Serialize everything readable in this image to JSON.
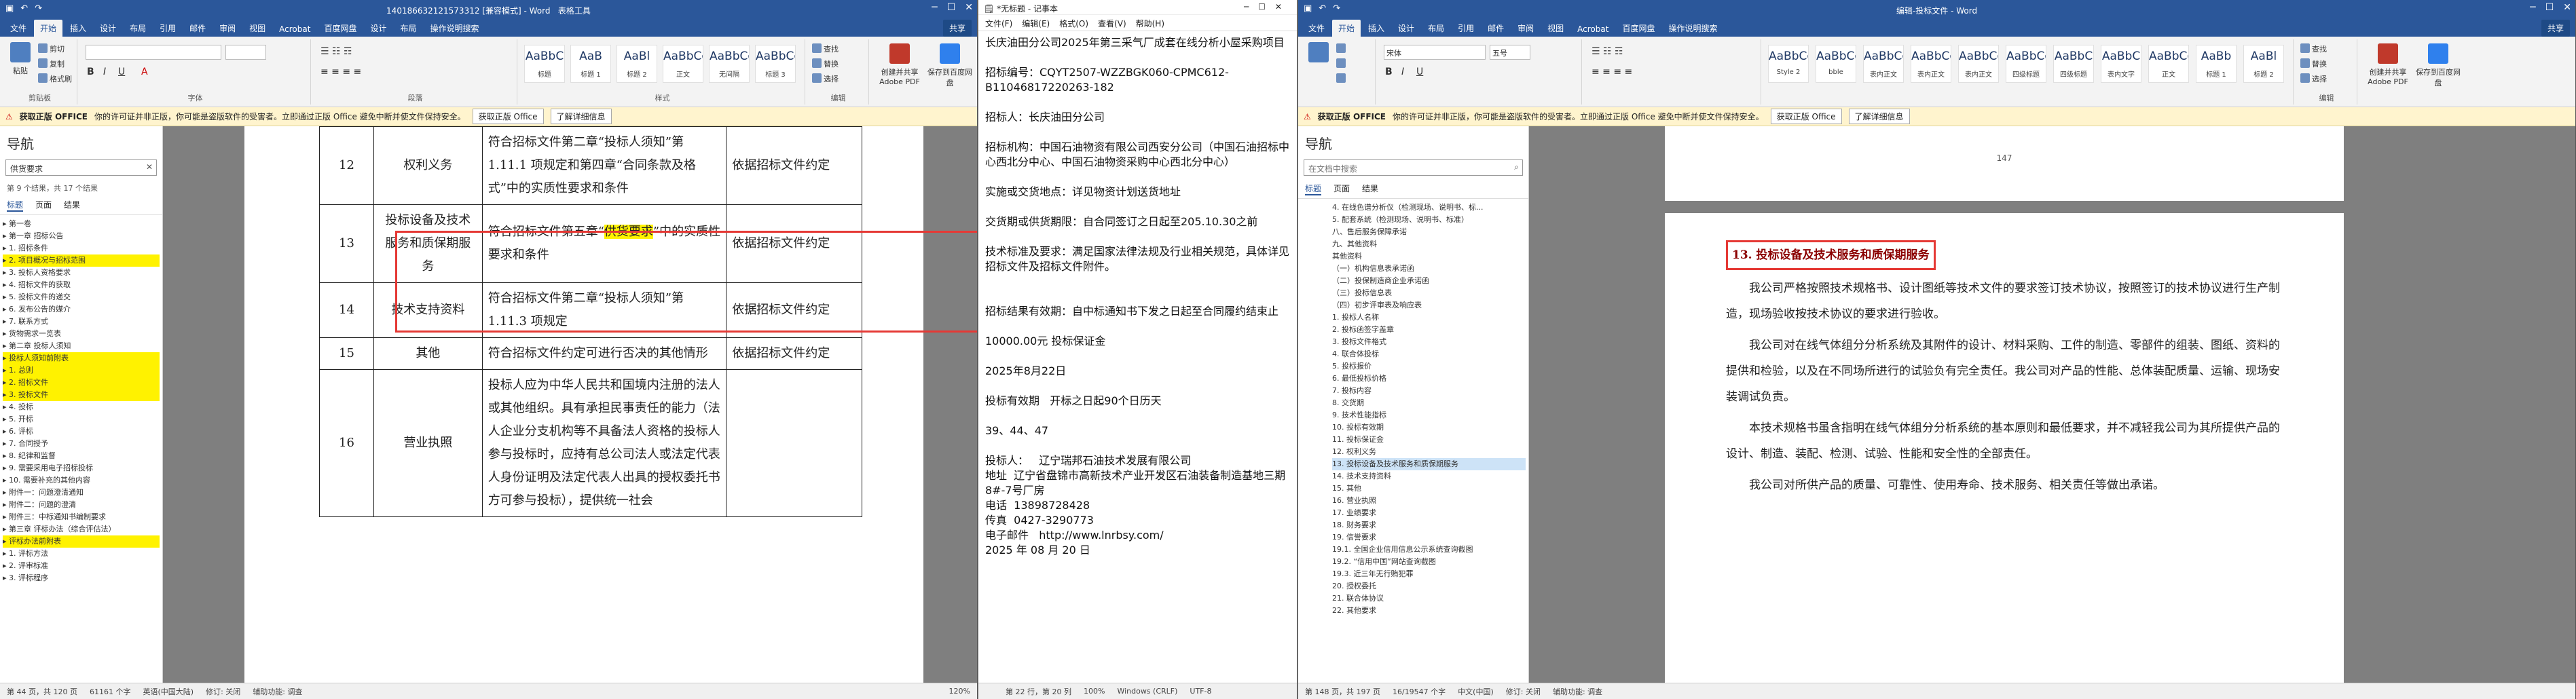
{
  "left": {
    "title": "14018663212157331​2 [兼容模式] - Word",
    "title_tools": "表格工具",
    "tabs": [
      "文件",
      "开始",
      "插入",
      "设计",
      "布局",
      "引用",
      "邮件",
      "审阅",
      "视图",
      "Acrobat",
      "百度网盘",
      "设计",
      "布局",
      "操作说明搜索"
    ],
    "share": "共享",
    "ribbon": {
      "paste": "粘贴",
      "cut": "剪切",
      "copy": "复制",
      "fmt": "格式刷",
      "clipboard": "剪贴板",
      "font_group": "字体",
      "para_group": "段落",
      "styles_group": "样式",
      "edit_group": "编辑",
      "find": "查找",
      "replace": "替换",
      "select": "选择",
      "pdf": "创建并共享 Adobe PDF",
      "baidu": "保存到百度网盘",
      "styles": [
        {
          "p": "AaBbC",
          "n": "标题"
        },
        {
          "p": "AaB",
          "n": "标题 1"
        },
        {
          "p": "AaBl",
          "n": "标题 2"
        },
        {
          "p": "AaBbCcD",
          "n": "正文"
        },
        {
          "p": "AaBbCcD",
          "n": "无间隔"
        },
        {
          "p": "AaBbCc",
          "n": "标题 3"
        }
      ]
    },
    "msg": {
      "label": "获取正版 OFFICE",
      "text": "你的许可证并非正版，你可能是盗版软件的受害者。立即通过正版 Office 避免中断并使文件保持安全。",
      "btn1": "获取正版 Office",
      "btn2": "了解详细信息"
    },
    "nav": {
      "title": "导航",
      "search": "供货要求",
      "result": "第 9 个结果，共 17 个结果",
      "tabs": [
        "标题",
        "页面",
        "结果"
      ],
      "items": [
        {
          "t": "第一卷",
          "h": false
        },
        {
          "t": "第一章 招标公告",
          "h": false
        },
        {
          "t": "1. 招标条件",
          "h": false
        },
        {
          "t": "2. 项目概况与招标范围",
          "h": true
        },
        {
          "t": "3. 投标人资格要求",
          "h": false
        },
        {
          "t": "4. 招标文件的获取",
          "h": false
        },
        {
          "t": "5. 投标文件的递交",
          "h": false
        },
        {
          "t": "6. 发布公告的媒介",
          "h": false
        },
        {
          "t": "7. 联系方式",
          "h": false
        },
        {
          "t": "货物需求一览表",
          "h": false
        },
        {
          "t": "第二章 投标人须知",
          "h": false
        },
        {
          "t": "投标人须知前附表",
          "h": true
        },
        {
          "t": "1. 总则",
          "h": true
        },
        {
          "t": "2. 招标文件",
          "h": true
        },
        {
          "t": "3. 投标文件",
          "h": true
        },
        {
          "t": "4. 投标",
          "h": false
        },
        {
          "t": "5. 开标",
          "h": false
        },
        {
          "t": "6. 评标",
          "h": false
        },
        {
          "t": "7. 合同授予",
          "h": false
        },
        {
          "t": "8. 纪律和监督",
          "h": false
        },
        {
          "t": "9. 需要采用电子招标投标",
          "h": false
        },
        {
          "t": "10. 需要补充的其他内容",
          "h": false
        },
        {
          "t": "附件一：问题澄清通知",
          "h": false
        },
        {
          "t": "附件二：问题的澄清",
          "h": false
        },
        {
          "t": "附件三：中标通知书编制要求",
          "h": false
        },
        {
          "t": "第三章 评标办法（综合评估法）",
          "h": false
        },
        {
          "t": "评标办法前附表",
          "h": true
        },
        {
          "t": "1. 评标方法",
          "h": false
        },
        {
          "t": "2. 评审标准",
          "h": false
        },
        {
          "t": "3. 评标程序",
          "h": false
        }
      ]
    },
    "table": [
      {
        "n": "12",
        "item": "权利义务",
        "req": "符合招标文件第二章“投标人须知”第 1.11.1 项规定和第四章“合同条款及格式”中的实质性要求和条件",
        "basis": "依据招标文件约定"
      },
      {
        "n": "13",
        "item": "投标设备及技术服务和质保期服务",
        "req_a": "符合招标文件第五章“",
        "req_hl": "供货要求",
        "req_b": "”中的实质性要求和条件",
        "basis": "依据招标文件约定"
      },
      {
        "n": "14",
        "item": "技术支持资料",
        "req": "符合招标文件第二章“投标人须知”第 1.11.3 项规定",
        "basis": "依据招标文件约定"
      },
      {
        "n": "15",
        "item": "其他",
        "req": "符合招标文件约定可进行否决的其他情形",
        "basis": "依据招标文件约定"
      },
      {
        "n": "16",
        "item": "营业执照",
        "req": "投标人应为中华人民共和国境内注册的法人或其他组织。具有承担民事责任的能力（法人企业分支机构等不具备法人资格的投标人参与投标时，应持有总公司法人或法定代表人身份证明及法定代表人出具的授权委托书方可参与投标），提供统一社会",
        "basis": ""
      }
    ],
    "status": {
      "page": "第 44 页，共 120 页",
      "words": "61161 个字",
      "lang": "英语(中国大陆)",
      "track": "修订: 关闭",
      "access": "辅助功能: 调查",
      "zoom": "120%"
    }
  },
  "notepad": {
    "title": "*无标题 - 记事本",
    "menu": [
      "文件(F)",
      "编辑(E)",
      "格式(O)",
      "查看(V)",
      "帮助(H)"
    ],
    "text": "长庆油田分公司2025年第三采气厂成套在线分析小屋采购项目\n\n招标编号：CQYT2507-WZZBGK060-CPMC612-B11046817220263-182\n\n招标人：长庆油田分公司\n\n招标机构：中国石油物资有限公司西安分公司（中国石油招标中心西北分中心、中国石油物资采购中心西北分中心）\n\n实施或交货地点：详见物资计划送货地址\n\n交货期或供货期限：自合同签订之日起至205.10.30之前\n\n技术标准及要求：满足国家法律法规及行业相关规范，具体详见招标文件及招标文件附件。\n\n\n招标结果有效期：自中标通知书下发之日起至合同履约结束止\n\n10000.00元 投标保证金\n\n2025年8月22日\n\n投标有效期   开标之日起90个日历天\n\n39、44、47\n\n投标人：   辽宁瑞邦石油技术发展有限公司\n地址  辽宁省盘锦市高新技术产业开发区石油装备制造基地三期8#-7号厂房\n电话  13898728428\n传真  0427-3290773\n电子邮件   http://www.lnrbsy.com/\n2025 年 08 月 20 日",
    "status": {
      "pos": "第 22 行，第 20 列",
      "zoom": "100%",
      "eol": "Windows (CRLF)",
      "enc": "UTF-8"
    }
  },
  "right": {
    "title": "编辑-投标文件 - Word",
    "tabs": [
      "文件",
      "开始",
      "插入",
      "设计",
      "布局",
      "引用",
      "邮件",
      "审阅",
      "视图",
      "Acrobat",
      "百度网盘",
      "操作说明搜索"
    ],
    "share": "共享",
    "ribbon": {
      "font": "宋体",
      "size": "五号",
      "styles": [
        {
          "p": "AaBbCcD",
          "n": "Style 2"
        },
        {
          "p": "AaBbCcD",
          "n": "bble"
        },
        {
          "p": "AaBbCcD",
          "n": "表内正文"
        },
        {
          "p": "AaBbCcD",
          "n": "表内正文"
        },
        {
          "p": "AaBbCcD",
          "n": "表内正文"
        },
        {
          "p": "AaBbCcD",
          "n": "四级标题"
        },
        {
          "p": "AaBbC",
          "n": "四级标题"
        },
        {
          "p": "AaBbC",
          "n": "表内文字"
        },
        {
          "p": "AaBbCcD",
          "n": "正文"
        },
        {
          "p": "AaBb",
          "n": "标题 1"
        },
        {
          "p": "AaBl",
          "n": "标题 2"
        }
      ],
      "find": "查找",
      "replace": "替换",
      "select": "选择",
      "pdf": "创建并共享 Adobe PDF",
      "baidu": "保存到百度网盘",
      "editing": "编辑"
    },
    "nav": {
      "title": "导航",
      "search": "在文档中搜索",
      "tabs": [
        "标题",
        "页面",
        "结果"
      ],
      "items": [
        {
          "t": "4. 在线色谱分析仪（检测现场、说明书、标...",
          "s": false
        },
        {
          "t": "5. 配套系统（检测现场、说明书、标准）",
          "s": false
        },
        {
          "t": "八、售后服务保障承诺",
          "s": false
        },
        {
          "t": "九、其他资料",
          "s": false
        },
        {
          "t": "其他资料",
          "s": false
        },
        {
          "t": "（一）机构信息表承诺函",
          "s": false
        },
        {
          "t": "（二）投保制造商企业承诺函",
          "s": false
        },
        {
          "t": "（三）投标信息表",
          "s": false
        },
        {
          "t": "（四）初步评审表及响应表",
          "s": false
        },
        {
          "t": "1. 投标人名称",
          "s": false
        },
        {
          "t": "2. 投标函签字盖章",
          "s": false
        },
        {
          "t": "3. 投标文件格式",
          "s": false
        },
        {
          "t": "4. 联合体投标",
          "s": false
        },
        {
          "t": "5. 投标报价",
          "s": false
        },
        {
          "t": "6. 最低投标价格",
          "s": false
        },
        {
          "t": "7. 投标内容",
          "s": false
        },
        {
          "t": "8. 交货期",
          "s": false
        },
        {
          "t": "9. 技术性能指标",
          "s": false
        },
        {
          "t": "10. 投标有效期",
          "s": false
        },
        {
          "t": "11. 投标保证金",
          "s": false
        },
        {
          "t": "12. 权利义务",
          "s": false
        },
        {
          "t": "13. 投标设备及技术服务和质保期服务",
          "s": true
        },
        {
          "t": "14. 技术支持资料",
          "s": false
        },
        {
          "t": "15. 其他",
          "s": false
        },
        {
          "t": "16. 营业执照",
          "s": false
        },
        {
          "t": "17. 业绩要求",
          "s": false
        },
        {
          "t": "18. 财务要求",
          "s": false
        },
        {
          "t": "19. 信誉要求",
          "s": false
        },
        {
          "t": "19.1. 全国企业信用信息公示系统查询截图",
          "s": false
        },
        {
          "t": "19.2. “信用中国”网站查询截图",
          "s": false
        },
        {
          "t": "19.3. 近三年无行贿犯罪",
          "s": false
        },
        {
          "t": "20. 授权委托",
          "s": false
        },
        {
          "t": "21. 联合体协议",
          "s": false
        },
        {
          "t": "22. 其他要求",
          "s": false
        }
      ]
    },
    "page_num": "147",
    "heading": "13. 投标设备及技术服务和质保期服务",
    "paras": [
      "我公司严格按照技术规格书、设计图纸等技术文件的要求签订技术协议，按照签订的技术协议进行生产制造，现场验收按技术协议的要求进行验收。",
      "我公司对在线气体组分分析系统及其附件的设计、材料采购、工件的制造、零部件的组装、图纸、资料的提供和检验，以及在不同场所进行的试验负有完全责任。我公司对产品的性能、总体装配质量、运输、现场安装调试负责。",
      "本技术规格书虽含指明在线气体组分分析系统的基本原则和最低要求，并不减轻我公司为其所提供产品的设计、制造、装配、检测、试验、性能和安全性的全部责任。",
      "我公司对所供产品的质量、可靠性、使用寿命、技术服务、相关责任等做出承诺。"
    ],
    "status": {
      "page": "第 148 页，共 197 页",
      "words": "16/19547 个字",
      "lang": "中文(中国)",
      "track": "修订: 关闭",
      "access": "辅助功能: 调查"
    }
  }
}
